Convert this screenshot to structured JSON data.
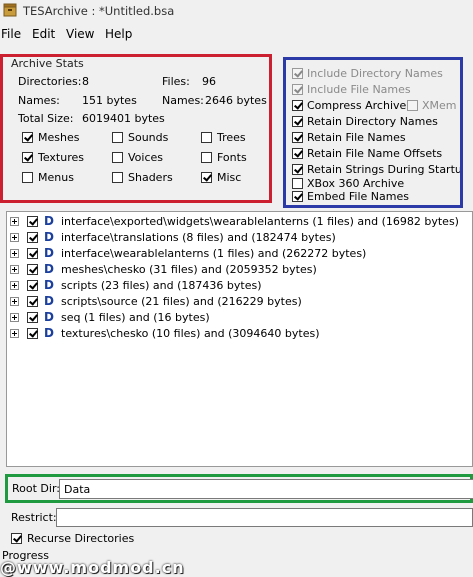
{
  "window": {
    "title": "TESArchive : *Untitled.bsa"
  },
  "menu": [
    "File",
    "Edit",
    "View",
    "Help"
  ],
  "archive_stats": {
    "legend": "Archive Stats",
    "directories_label": "Directories:",
    "directories_value": "8",
    "files_label": "Files:",
    "files_value": "96",
    "names_label": "Names:",
    "names_value": "151 bytes",
    "names2_label": "Names:",
    "names2_value": "2646 bytes",
    "total_label": "Total Size:",
    "total_value": "6019401 bytes",
    "types": [
      {
        "label": "Meshes",
        "checked": true
      },
      {
        "label": "Sounds",
        "checked": false
      },
      {
        "label": "Trees",
        "checked": false
      },
      {
        "label": "Textures",
        "checked": true
      },
      {
        "label": "Voices",
        "checked": false
      },
      {
        "label": "Fonts",
        "checked": false
      },
      {
        "label": "Menus",
        "checked": false
      },
      {
        "label": "Shaders",
        "checked": false
      },
      {
        "label": "Misc",
        "checked": true
      }
    ]
  },
  "options": {
    "include_dir_names": "Include Directory Names",
    "include_file_names": "Include File Names",
    "compress_archive": "Compress Archive",
    "xmem_codec": "XMem Codec",
    "retain_dir_names": "Retain Directory Names",
    "retain_file_names": "Retain File Names",
    "retain_file_offsets": "Retain File Name Offsets",
    "retain_strings": "Retain Strings During Startup",
    "xbox360": "XBox 360 Archive",
    "embed_file_names": "Embed File Names"
  },
  "tree": [
    "interface\\exported\\widgets\\wearablelanterns (1 files) and (16982 bytes)",
    "interface\\translations (8 files) and (182474 bytes)",
    "interface\\wearablelanterns (1 files) and (262272 bytes)",
    "meshes\\chesko (31 files) and (2059352 bytes)",
    "scripts (23 files) and (187436 bytes)",
    "scripts\\source (21 files) and (216229 bytes)",
    "seq (1 files) and (16 bytes)",
    "textures\\chesko (10 files) and (3094640 bytes)"
  ],
  "tree_icon": "D",
  "root_dir": {
    "label": "Root Dir:",
    "value": "Data"
  },
  "restrict": {
    "label": "Restrict:",
    "value": ""
  },
  "recurse": {
    "label": "Recurse Directories",
    "checked": true
  },
  "progress_label": "Progress",
  "watermark": "@www.modmod.cn"
}
